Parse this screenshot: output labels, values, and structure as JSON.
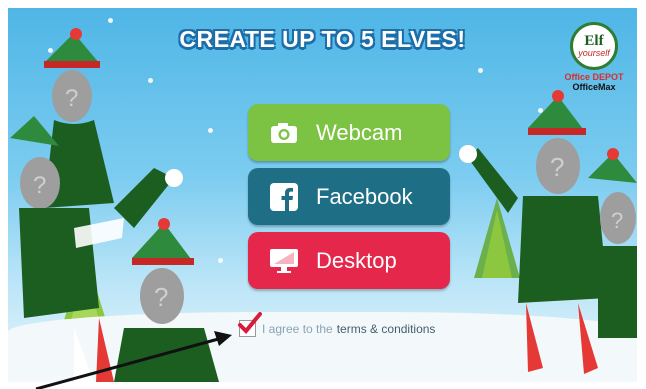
{
  "title": "CREATE UP TO 5 ELVES!",
  "logo": {
    "line1": "Elf",
    "line2": "yourself",
    "brand1": "Office DEPOT",
    "brand2": "OfficeMax"
  },
  "buttons": {
    "webcam": "Webcam",
    "facebook": "Facebook",
    "desktop": "Desktop"
  },
  "agreement": {
    "text": "I agree to the",
    "link": "terms & conditions",
    "checked": true
  },
  "colors": {
    "webcam": "#7cc243",
    "facebook": "#1e6f86",
    "desktop": "#e4274b",
    "sky": "#4fb6e6"
  },
  "icons": [
    "camera-icon",
    "facebook-icon",
    "monitor-icon",
    "checkmark-icon"
  ]
}
